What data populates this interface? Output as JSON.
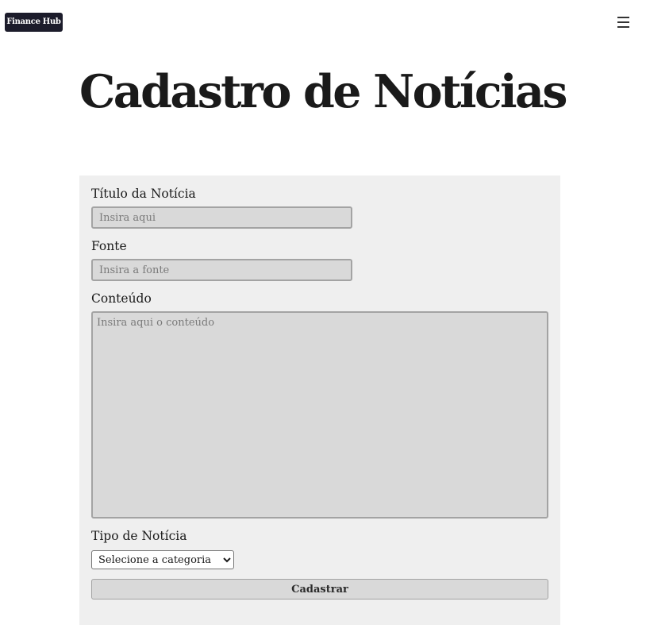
{
  "brand": {
    "logo_text": "Finance Hub"
  },
  "header": {
    "menu_icon": "hamburger-menu-icon"
  },
  "page": {
    "title": "Cadastro de Notícias"
  },
  "form": {
    "title_field": {
      "label": "Título da Notícia",
      "placeholder": "Insira aqui",
      "value": ""
    },
    "source_field": {
      "label": "Fonte",
      "placeholder": "Insira a fonte",
      "value": ""
    },
    "content_field": {
      "label": "Conteúdo",
      "placeholder": "Insira aqui o conteúdo",
      "value": ""
    },
    "type_field": {
      "label": "Tipo de Notícia",
      "selected": "Selecione a categoria"
    },
    "submit_label": "Cadastrar"
  },
  "colors": {
    "logo_background": "#1c1c2b",
    "panel_background": "#efefef",
    "input_background": "#d9d9d9"
  }
}
